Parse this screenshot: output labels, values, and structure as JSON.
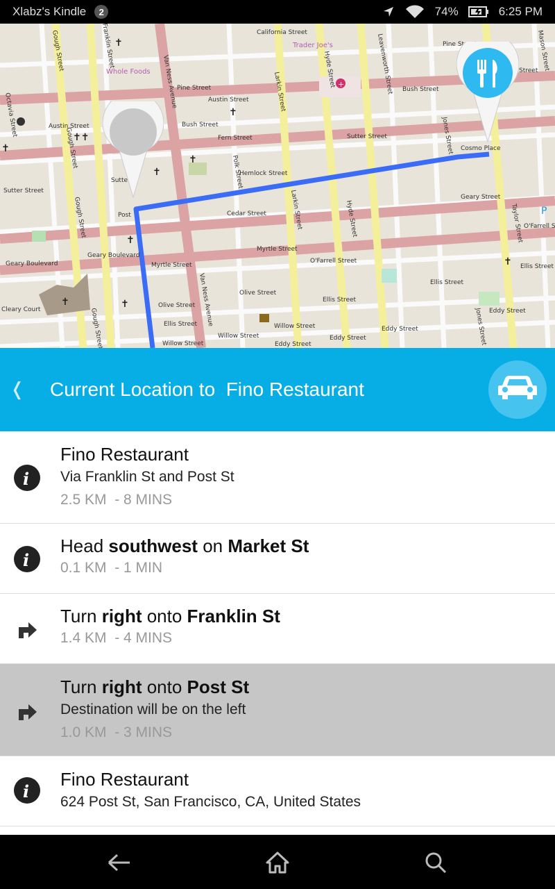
{
  "status_bar": {
    "device_name": "Xlabz's Kindle",
    "notification_count": "2",
    "battery": "74%",
    "time": "6:25 PM",
    "icons": [
      "location-arrow-icon",
      "wifi-icon",
      "battery-icon"
    ]
  },
  "map": {
    "streets": {
      "california": "California Street",
      "pine": "Pine Street",
      "bush": "Bush Street",
      "sutter": "Sutter Street",
      "post": "Post",
      "cedar": "Cedar Street",
      "geary": "Geary Street",
      "geary_blvd": "Geary Boulevard",
      "myrtle": "Myrtle Street",
      "ofarrell": "O'Farrell Street",
      "olive": "Olive Street",
      "ellis": "Ellis Street",
      "willow": "Willow Street",
      "eddy": "Eddy Street",
      "austin": "Austin Street",
      "fern": "Fern Street",
      "hemlock": "Hemlock Street",
      "cosmo": "Cosmo Place",
      "van_ness": "Van Ness Avenue",
      "polk": "Polk Street",
      "larkin": "Larkin Street",
      "hyde": "Hyde Street",
      "leavenworth": "Leavenworth Street",
      "jones": "Jones Street",
      "taylor": "Taylor Street",
      "mason": "Mason Street",
      "gough": "Gough Street",
      "octavia": "Octavia Street",
      "franklin": "Franklin Street",
      "cleary": "Cleary Court"
    },
    "pois": {
      "whole_foods": "Whole Foods",
      "trader_joes": "Trader Joe's"
    },
    "markers": {
      "origin": "origin-pin-icon",
      "destination": "restaurant-pin-icon"
    },
    "colors": {
      "route": "#3b6cf5",
      "major_road": "#dba3a3",
      "minor_road": "#f4ef9a",
      "block": "#e9e4da"
    }
  },
  "header": {
    "back_icon": "chevron-left-icon",
    "title": "Current Location to  Fino Restaurant",
    "mode_icon": "car-icon",
    "color": "#07aee6"
  },
  "steps": [
    {
      "icon": "info-icon",
      "title": "Fino Restaurant",
      "subtitle": "Via Franklin St and Post St",
      "distance": "2.5 KM",
      "duration": "- 8 MINS"
    },
    {
      "icon": "info-icon",
      "title_parts": [
        "Head ",
        "southwest",
        " on ",
        "Market St"
      ],
      "distance": "0.1 KM",
      "duration": "- 1 MIN"
    },
    {
      "icon": "turn-right-icon",
      "title_parts": [
        "Turn ",
        "right",
        " onto ",
        "Franklin St"
      ],
      "distance": "1.4 KM",
      "duration": "- 4 MINS"
    },
    {
      "icon": "turn-right-icon",
      "title_parts": [
        "Turn ",
        "right",
        " onto ",
        "Post St"
      ],
      "subtitle": "Destination will be on the left",
      "distance": "1.0 KM",
      "duration": "- 3 MINS"
    },
    {
      "icon": "info-icon",
      "title": "Fino Restaurant",
      "subtitle": "624 Post St, San Francisco, CA, United States"
    }
  ],
  "nav_bar": {
    "icons": [
      "back-arrow-icon",
      "home-icon",
      "search-icon"
    ]
  }
}
